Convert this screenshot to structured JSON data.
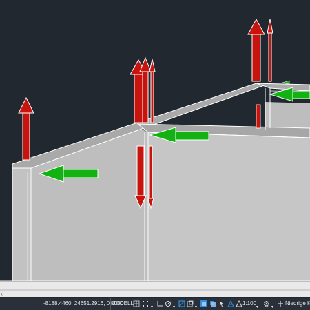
{
  "command_line": {
    "prompt_symbol": "‹"
  },
  "status_bar": {
    "coordinates": "-8188.4460, 24651.2916, 0.0000",
    "model_label": "MODELL",
    "scale": "1:100",
    "performance_label": "Niedrige Kor"
  },
  "colors": {
    "model_background": "#212830",
    "wall_face": "#c4c4c4",
    "wall_edge": "#ffffff",
    "arrow_red": "#c8140f",
    "arrow_green": "#13b213",
    "status_bar_bg": "#2a3039",
    "active_icon": "#2f8ee0"
  },
  "icons": [
    "grid-icon",
    "snap-icon",
    "ortho-icon",
    "polar-icon",
    "osnap-icon",
    "layers-icon",
    "transparency-icon",
    "selection-cycling-icon",
    "annotation-visibility-icon",
    "autoscale-icon",
    "annotation-scale-icon",
    "settings-gear-icon",
    "plus-icon"
  ]
}
